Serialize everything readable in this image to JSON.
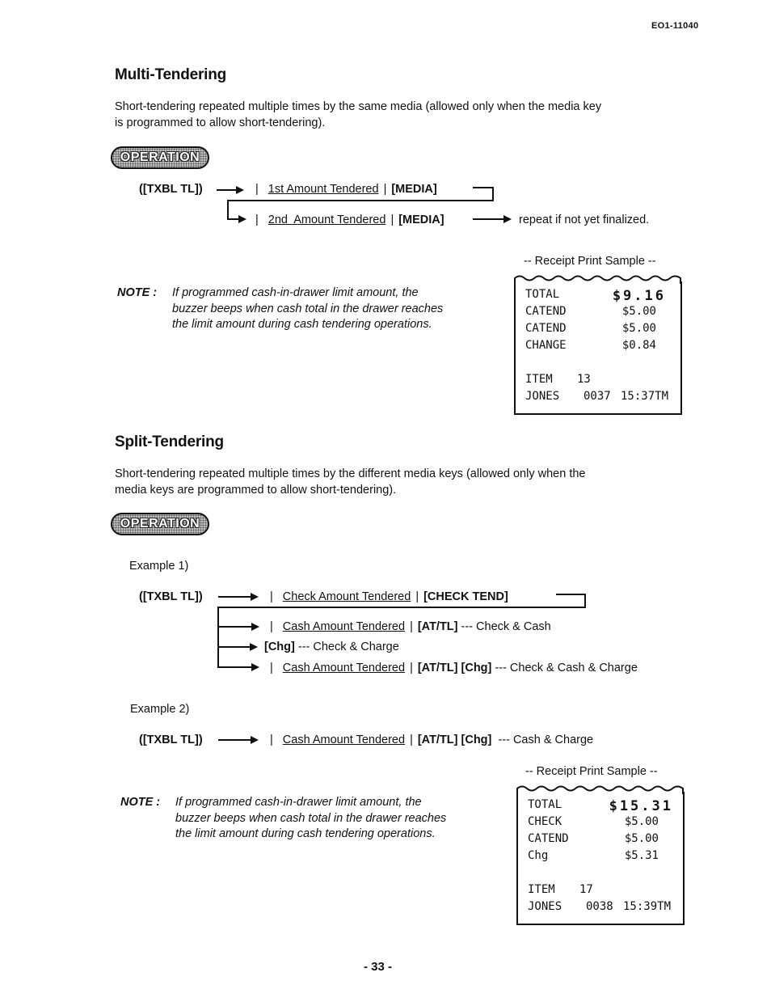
{
  "header": {
    "doc_id": "EO1-11040"
  },
  "multi": {
    "title": "Multi-Tendering",
    "desc_1": "Short-tendering repeated multiple times by the same media (allowed only when the media key",
    "desc_2": "is programmed to allow short-tendering).",
    "badge": "OPERATION",
    "flow": {
      "start": "([TXBL TL])",
      "step1_amount": "1st Amount Tendered",
      "step1_key": "[MEDIA]",
      "step2_amount": "2nd  Amount Tendered",
      "step2_key": "[MEDIA]",
      "repeat": "repeat if not yet finalized."
    },
    "note": {
      "label": "NOTE :",
      "line_1": "If programmed cash-in-drawer limit amount, the",
      "line_2": "buzzer beeps when cash total in the drawer reaches",
      "line_3": "the limit amount during cash tendering operations."
    },
    "receipt": {
      "caption": "-- Receipt Print Sample --",
      "rows": [
        {
          "k": "TOTAL",
          "v": "$9.16"
        },
        {
          "k": "CATEND",
          "v": "$5.00"
        },
        {
          "k": "CATEND",
          "v": "$5.00"
        },
        {
          "k": "CHANGE",
          "v": "$0.84"
        }
      ],
      "item_label": "ITEM",
      "item_count": "13",
      "clerk": "JONES",
      "consec": "0037",
      "time": "15:37TM"
    }
  },
  "split": {
    "title": "Split-Tendering",
    "desc_1": "Short-tendering repeated multiple times by the different media keys (allowed only when the",
    "desc_2": "media keys are programmed to allow short-tendering).",
    "badge": "OPERATION",
    "example1": {
      "label": "Example 1)",
      "start": "([TXBL TL])",
      "step_amount": "Check Amount Tendered",
      "step_key": "[CHECK TEND]",
      "branches": [
        {
          "amount": "Cash Amount Tendered",
          "keys": "[AT/TL]",
          "desc": "--- Check & Cash"
        },
        {
          "amount": "",
          "keys": "[Chg]",
          "desc": "--- Check & Charge"
        },
        {
          "amount": "Cash Amount Tendered",
          "keys": "[AT/TL] [Chg]",
          "desc": "--- Check & Cash & Charge"
        }
      ]
    },
    "example2": {
      "label": "Example 2)",
      "start": "([TXBL TL])",
      "amount": "Cash Amount Tendered",
      "keys": "[AT/TL] [Chg]",
      "desc": "--- Cash & Charge"
    },
    "note": {
      "label": "NOTE :",
      "line_1": "If programmed cash-in-drawer limit amount, the",
      "line_2": "buzzer beeps when cash total in the drawer reaches",
      "line_3": "the limit amount during cash tendering operations."
    },
    "receipt": {
      "caption": "-- Receipt Print Sample --",
      "rows": [
        {
          "k": "TOTAL",
          "v": "$15.31"
        },
        {
          "k": "CHECK",
          "v": "$5.00"
        },
        {
          "k": "CATEND",
          "v": "$5.00"
        },
        {
          "k": "Chg",
          "v": "$5.31"
        }
      ],
      "item_label": "ITEM",
      "item_count": "17",
      "clerk": "JONES",
      "consec": "0038",
      "time": "15:39TM"
    }
  },
  "footer": {
    "page_number": "- 33 -"
  }
}
